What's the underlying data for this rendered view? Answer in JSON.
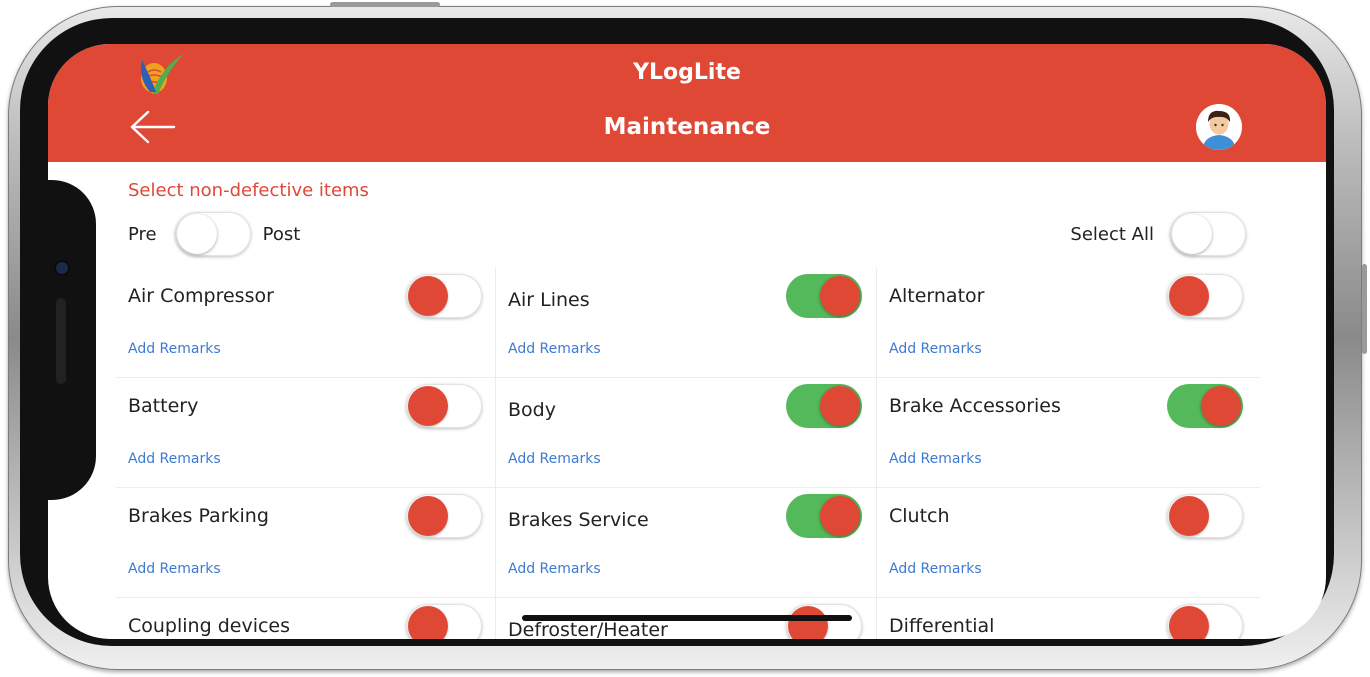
{
  "app": {
    "title": "YLogLite",
    "screen_title": "Maintenance",
    "accent": "#e04836",
    "toggle_on_color": "#54b95a"
  },
  "header": {
    "back_icon": "arrow-left-icon",
    "avatar_icon": "user-avatar-icon",
    "logo_icon": "leaf-logo-icon"
  },
  "instruction": "Select non-defective items",
  "mode": {
    "pre_label": "Pre",
    "post_label": "Post",
    "post_selected": false
  },
  "select_all": {
    "label": "Select All",
    "on": false
  },
  "items": [
    {
      "label": "Air Compressor",
      "on": false,
      "remarks": "Add Remarks"
    },
    {
      "label": "Air Lines",
      "on": true,
      "remarks": "Add Remarks"
    },
    {
      "label": "Alternator",
      "on": false,
      "remarks": "Add Remarks"
    },
    {
      "label": "Battery",
      "on": false,
      "remarks": "Add Remarks"
    },
    {
      "label": "Body",
      "on": true,
      "remarks": "Add Remarks"
    },
    {
      "label": "Brake Accessories",
      "on": true,
      "remarks": "Add Remarks"
    },
    {
      "label": "Brakes Parking",
      "on": false,
      "remarks": "Add Remarks"
    },
    {
      "label": "Brakes Service",
      "on": true,
      "remarks": "Add Remarks"
    },
    {
      "label": "Clutch",
      "on": false,
      "remarks": "Add Remarks"
    },
    {
      "label": "Coupling devices",
      "on": false,
      "remarks": ""
    },
    {
      "label": "Defroster/Heater",
      "on": false,
      "remarks": ""
    },
    {
      "label": "Differential",
      "on": false,
      "remarks": ""
    }
  ]
}
